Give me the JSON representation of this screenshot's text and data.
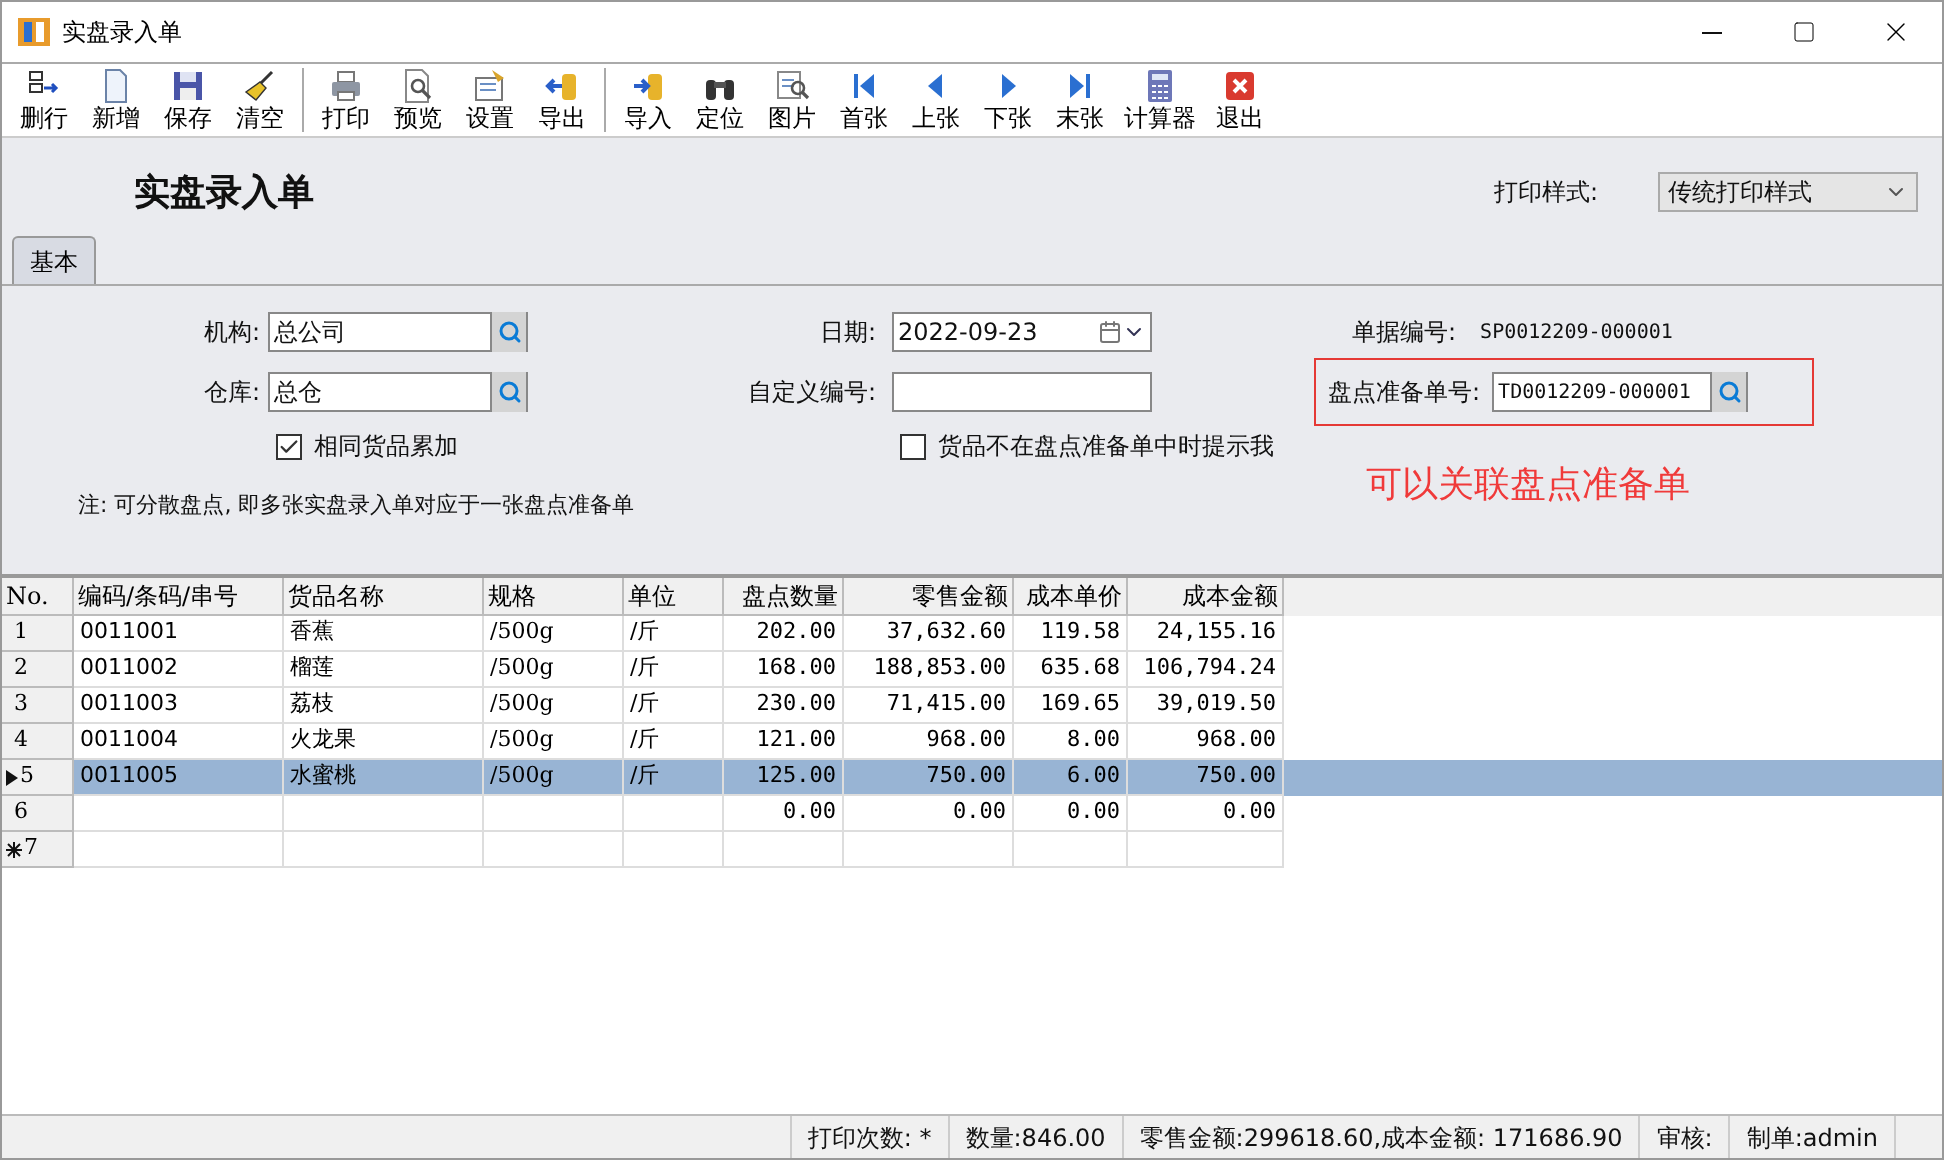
{
  "window": {
    "title": "实盘录入单"
  },
  "toolbar": [
    {
      "label": "删行"
    },
    {
      "label": "新增"
    },
    {
      "label": "保存"
    },
    {
      "label": "清空"
    },
    {
      "label": "打印"
    },
    {
      "label": "预览"
    },
    {
      "label": "设置"
    },
    {
      "label": "导出"
    },
    {
      "label": "导入"
    },
    {
      "label": "定位"
    },
    {
      "label": "图片"
    },
    {
      "label": "首张"
    },
    {
      "label": "上张"
    },
    {
      "label": "下张"
    },
    {
      "label": "末张"
    },
    {
      "label": "计算器"
    },
    {
      "label": "退出"
    }
  ],
  "form": {
    "heading": "实盘录入单",
    "print_style_label": "打印样式:",
    "print_style_value": "传统打印样式",
    "tabs": [
      {
        "label": "基本",
        "selected": true
      }
    ],
    "org_label": "机构:",
    "org_value": "总公司",
    "warehouse_label": "仓库:",
    "warehouse_value": "总仓",
    "accumulate": {
      "label": "相同货品累加",
      "checked": true
    },
    "date_label": "日期:",
    "date_value": "2022-09-23",
    "custom_no_label": "自定义编号:",
    "notify": {
      "label": "货品不在盘点准备单中时提示我",
      "checked": false
    },
    "doc_no_label": "单据编号:",
    "doc_no_value": "SP0012209-000001",
    "prep_no_label": "盘点准备单号:",
    "prep_no_value": "TD0012209-000001",
    "note": "注: 可分散盘点, 即多张实盘录入单对应于一张盘点准备单",
    "annotation": "可以关联盘点准备单"
  },
  "table": {
    "columns": [
      "No.",
      "编码/条码/串号",
      "货品名称",
      "规格",
      "单位",
      "盘点数量",
      "零售金额",
      "成本单价",
      "成本金额"
    ],
    "rows": [
      {
        "selected": false,
        "kind": "normal",
        "cells": [
          "1",
          "0011001",
          "香蕉",
          "/500g",
          "/斤",
          "202.00",
          "37,632.60",
          "119.58",
          "24,155.16"
        ]
      },
      {
        "selected": false,
        "kind": "normal",
        "cells": [
          "2",
          "0011002",
          "榴莲",
          "/500g",
          "/斤",
          "168.00",
          "188,853.00",
          "635.68",
          "106,794.24"
        ]
      },
      {
        "selected": false,
        "kind": "normal",
        "cells": [
          "3",
          "0011003",
          "荔枝",
          "/500g",
          "/斤",
          "230.00",
          "71,415.00",
          "169.65",
          "39,019.50"
        ]
      },
      {
        "selected": false,
        "kind": "normal",
        "cells": [
          "4",
          "0011004",
          "火龙果",
          "/500g",
          "/斤",
          "121.00",
          "968.00",
          "8.00",
          "968.00"
        ]
      },
      {
        "selected": true,
        "kind": "normal",
        "cells": [
          "5",
          "0011005",
          "水蜜桃",
          "/500g",
          "/斤",
          "125.00",
          "750.00",
          "6.00",
          "750.00"
        ]
      },
      {
        "selected": false,
        "kind": "normal",
        "cells": [
          "6",
          "",
          "",
          "",
          "",
          "0.00",
          "0.00",
          "0.00",
          "0.00"
        ]
      },
      {
        "selected": false,
        "kind": "new",
        "cells": [
          "7",
          "",
          "",
          "",
          "",
          "",
          "",
          "",
          ""
        ]
      }
    ]
  },
  "status_bar": [
    "打印次数: *",
    "数量:846.00",
    "零售金额:299618.60,成本金额: 171686.90",
    "审核:",
    "制单:admin"
  ]
}
